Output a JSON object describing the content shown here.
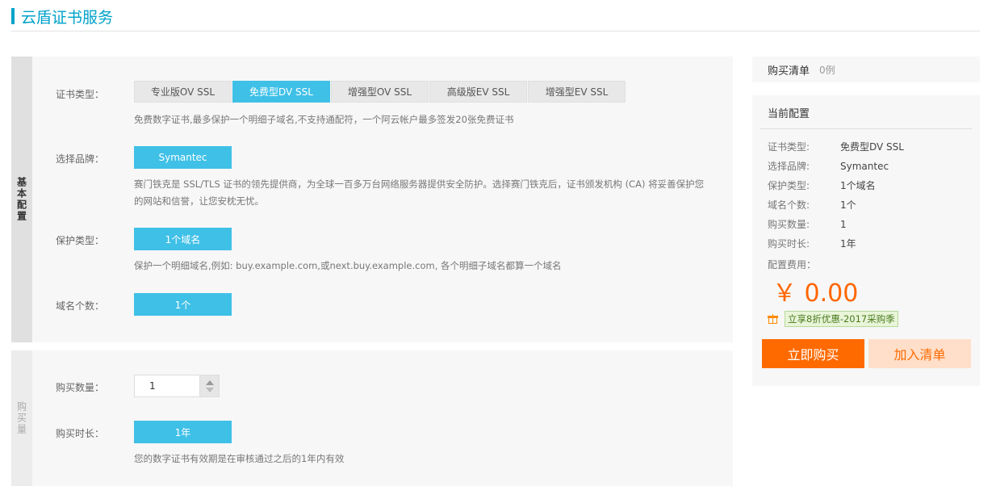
{
  "page": {
    "title": "云盾证书服务"
  },
  "basic": {
    "section_label": "基本配置",
    "cert_type": {
      "label": "证书类型：",
      "tabs": [
        "专业版OV SSL",
        "免费型DV SSL",
        "增强型OV SSL",
        "高级版EV SSL",
        "增强型EV SSL"
      ],
      "active_index": 1,
      "help": "免费数字证书,最多保护一个明细子域名,不支持通配符，一个阿云帐户最多签发20张免费证书"
    },
    "brand": {
      "label": "选择品牌：",
      "value": "Symantec",
      "help_line1": "赛门铁克是 SSL/TLS 证书的领先提供商，为全球一百多万台网络服务器提供安全防护。选择赛门铁克后，证书颁发机构 (CA) 将妥善保护您",
      "help_line2": "的网站和信誉，让您安枕无忧。"
    },
    "protect": {
      "label": "保护类型：",
      "value": "1个域名",
      "help": "保护一个明细域名,例如: buy.example.com,或next.buy.example.com, 各个明细子域名都算一个域名"
    },
    "domain_count": {
      "label": "域名个数：",
      "value": "1个"
    }
  },
  "quantity_section": {
    "section_label": "购买量",
    "qty": {
      "label": "购买数量：",
      "value": "1"
    },
    "duration": {
      "label": "购买时长：",
      "value": "1年",
      "help": "您的数字证书有效期是在审核通过之后的1年内有效"
    }
  },
  "cart": {
    "label": "购买清单",
    "count": "0例"
  },
  "config": {
    "title": "当前配置",
    "rows": [
      {
        "k": "证书类型:",
        "v": "免费型DV SSL"
      },
      {
        "k": "选择品牌:",
        "v": "Symantec"
      },
      {
        "k": "保护类型:",
        "v": "1个域名"
      },
      {
        "k": "域名个数:",
        "v": "1个"
      },
      {
        "k": "购买数量:",
        "v": "1"
      },
      {
        "k": "购买时长:",
        "v": "1年"
      }
    ],
    "fee_label": "配置费用：",
    "price": "￥ 0.00",
    "promo": "立享8折优惠-2017采购季",
    "buy_button": "立即购买",
    "add_button": "加入清单"
  },
  "colors": {
    "accent": "#3fc0e7",
    "title": "#00a2ca",
    "price": "#ff6600",
    "buy": "#ff6a00"
  },
  "icons": {
    "promo": "gift-icon"
  }
}
